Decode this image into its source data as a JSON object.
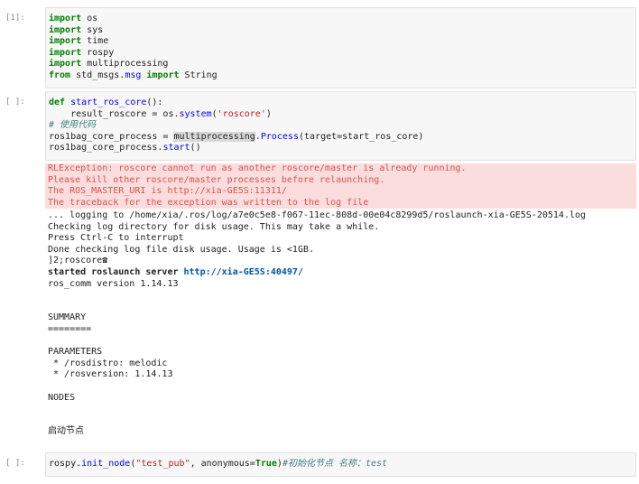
{
  "cells": [
    {
      "prompt": "[1]:",
      "lines": [
        [
          {
            "t": "import",
            "c": "kw"
          },
          {
            "t": " os",
            "c": ""
          }
        ],
        [
          {
            "t": "import",
            "c": "kw"
          },
          {
            "t": " sys",
            "c": ""
          }
        ],
        [
          {
            "t": "import",
            "c": "kw"
          },
          {
            "t": " time",
            "c": ""
          }
        ],
        [
          {
            "t": "import",
            "c": "kw"
          },
          {
            "t": " rospy",
            "c": ""
          }
        ],
        [
          {
            "t": "import",
            "c": "kw"
          },
          {
            "t": " multiprocessing",
            "c": ""
          }
        ],
        [
          {
            "t": "from",
            "c": "kw"
          },
          {
            "t": " std_msgs.",
            "c": ""
          },
          {
            "t": "msg",
            "c": "mod"
          },
          {
            "t": " ",
            "c": ""
          },
          {
            "t": "import",
            "c": "kw"
          },
          {
            "t": " String",
            "c": ""
          }
        ]
      ]
    },
    {
      "prompt": "[ ]:",
      "lines": [
        [
          {
            "t": "def",
            "c": "kw"
          },
          {
            "t": " ",
            "c": ""
          },
          {
            "t": "start_ros_core",
            "c": "fn"
          },
          {
            "t": "():",
            "c": ""
          }
        ],
        [
          {
            "t": "    result_roscore = os.",
            "c": ""
          },
          {
            "t": "system",
            "c": "fn"
          },
          {
            "t": "(",
            "c": ""
          },
          {
            "t": "'roscore'",
            "c": "str"
          },
          {
            "t": ")",
            "c": ""
          }
        ],
        [
          {
            "t": "# 使用代码",
            "c": "com"
          }
        ],
        [
          {
            "t": "ros1bag_core_process = ",
            "c": ""
          },
          {
            "t": "multiprocessing",
            "c": "hl"
          },
          {
            "t": ".",
            "c": ""
          },
          {
            "t": "Process",
            "c": "fn"
          },
          {
            "t": "(target=start_ros_core)",
            "c": ""
          }
        ],
        [
          {
            "t": "ros1bag_core_process.",
            "c": ""
          },
          {
            "t": "start",
            "c": "fn"
          },
          {
            "t": "()",
            "c": ""
          }
        ]
      ]
    },
    {
      "prompt": "[ ]:",
      "lines": [
        [
          {
            "t": "rospy.",
            "c": ""
          },
          {
            "t": "init_node",
            "c": "fn"
          },
          {
            "t": "(",
            "c": ""
          },
          {
            "t": "\"test_pub\"",
            "c": "str"
          },
          {
            "t": ", anonymous=",
            "c": ""
          },
          {
            "t": "True",
            "c": "kw"
          },
          {
            "t": ")",
            "c": ""
          },
          {
            "t": "#初始化节点 名称：test",
            "c": "com"
          }
        ]
      ]
    }
  ],
  "stderr": [
    "RLException: roscore cannot run as another roscore/master is already running.",
    "Please kill other roscore/master processes before relaunching.",
    "The ROS_MASTER_URI is http://xia-GE5S:11311/",
    "The traceback for the exception was written to the log file"
  ],
  "stdout": [
    {
      "text": "... logging to /home/xia/.ros/log/a7e0c5e8-f067-11ec-808d-00e04c8299d5/roslaunch-xia-GE5S-20514.log",
      "style": ""
    },
    {
      "text": "Checking log directory for disk usage. This may take a while.",
      "style": ""
    },
    {
      "text": "Press Ctrl-C to interrupt",
      "style": ""
    },
    {
      "text": "Done checking log file disk usage. Usage is <1GB.",
      "style": ""
    },
    {
      "text": "]2;roscore☎",
      "style": ""
    },
    {
      "text": "started roslaunch server ",
      "style": "bold",
      "link": "http://xia-GE5S:40497/"
    },
    {
      "text": "ros_comm version 1.14.13",
      "style": ""
    },
    {
      "text": "",
      "style": ""
    },
    {
      "text": "",
      "style": ""
    },
    {
      "text": "SUMMARY",
      "style": ""
    },
    {
      "text": "========",
      "style": ""
    },
    {
      "text": "",
      "style": ""
    },
    {
      "text": "PARAMETERS",
      "style": ""
    },
    {
      "text": " * /rosdistro: melodic",
      "style": ""
    },
    {
      "text": " * /rosversion: 1.14.13",
      "style": ""
    },
    {
      "text": "",
      "style": ""
    },
    {
      "text": "NODES",
      "style": ""
    },
    {
      "text": "",
      "style": ""
    },
    {
      "text": "",
      "style": ""
    },
    {
      "text": "启动节点",
      "style": ""
    }
  ]
}
